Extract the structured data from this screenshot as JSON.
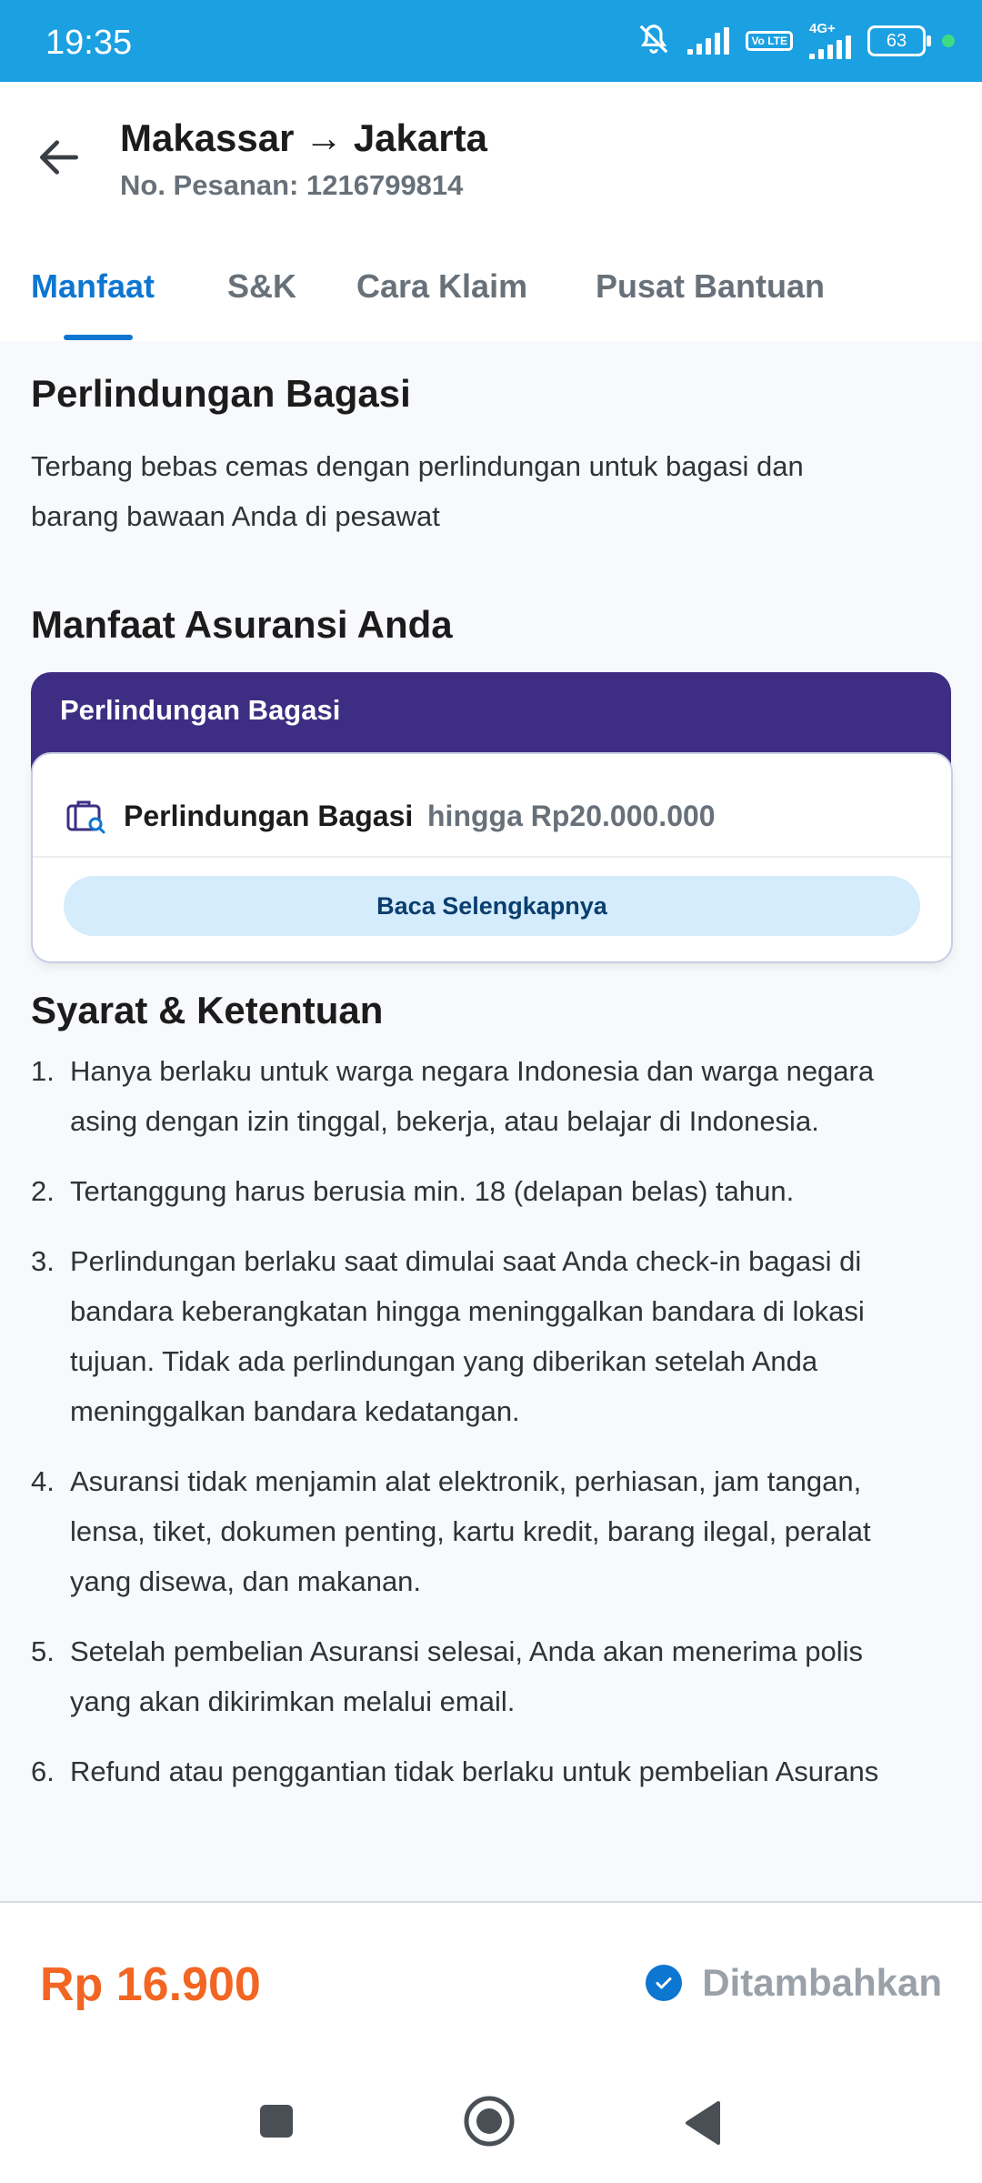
{
  "status_bar": {
    "time": "19:35",
    "volte": "Vo LTE",
    "network_type": "4G+",
    "battery": "63",
    "icons": [
      "mute-icon",
      "signal-icon",
      "volte-icon",
      "signal-icon",
      "battery-icon",
      "notification-dot-icon"
    ]
  },
  "header": {
    "title": "Makassar → Jakarta",
    "subtitle": "No. Pesanan: 1216799814",
    "back_icon": "arrow-left-icon"
  },
  "tabs": [
    {
      "label": "Manfaat",
      "active": true
    },
    {
      "label": "S&K",
      "active": false
    },
    {
      "label": "Cara Klaim",
      "active": false
    },
    {
      "label": "Pusat Bantuan",
      "active": false
    }
  ],
  "intro": {
    "heading": "Perlindungan Bagasi",
    "description_lines": [
      "Terbang bebas cemas dengan perlindungan untuk bagasi dan",
      "barang bawaan Anda di pesawat"
    ]
  },
  "benefits": {
    "heading": "Manfaat Asuransi Anda",
    "card_title": "Perlindungan Bagasi",
    "item_name": "Perlindungan Bagasi",
    "item_limit": "hingga Rp20.000.000",
    "item_icon": "luggage-search-icon",
    "read_more": "Baca Selengkapnya"
  },
  "terms": {
    "heading": "Syarat & Ketentuan",
    "items": [
      {
        "num": "1.",
        "lines": [
          "Hanya berlaku untuk warga negara Indonesia dan warga negara",
          "asing dengan izin tinggal, bekerja, atau belajar di Indonesia."
        ]
      },
      {
        "num": "2.",
        "lines": [
          "Tertanggung harus berusia min. 18 (delapan belas) tahun."
        ]
      },
      {
        "num": "3.",
        "lines": [
          "Perlindungan berlaku saat dimulai saat Anda check-in bagasi di",
          "bandara keberangkatan hingga meninggalkan bandara di lokasi",
          "tujuan. Tidak ada perlindungan yang diberikan setelah Anda",
          "meninggalkan bandara kedatangan."
        ]
      },
      {
        "num": "4.",
        "lines": [
          "Asuransi tidak menjamin alat elektronik, perhiasan, jam tangan,",
          "lensa, tiket, dokumen penting, kartu kredit, barang ilegal, peralat",
          "yang disewa, dan makanan."
        ]
      },
      {
        "num": "5.",
        "lines": [
          "Setelah pembelian Asuransi selesai, Anda akan menerima polis",
          "yang akan dikirimkan melalui email."
        ]
      },
      {
        "num": "6.",
        "lines": [
          "Refund atau penggantian tidak berlaku untuk pembelian Asurans"
        ]
      }
    ]
  },
  "footer": {
    "price": "Rp 16.900",
    "status_label": "Ditambahkan",
    "status_icon": "check-circle-icon"
  },
  "navbar": {
    "buttons": [
      "recents-square-icon",
      "home-circle-icon",
      "back-triangle-icon"
    ]
  },
  "colors": {
    "status_bar": "#1ba0e2",
    "accent_blue": "#0d76d1",
    "card_header": "#3d2e83",
    "price_orange": "#f26522",
    "read_more_bg": "#d4ecfb"
  }
}
